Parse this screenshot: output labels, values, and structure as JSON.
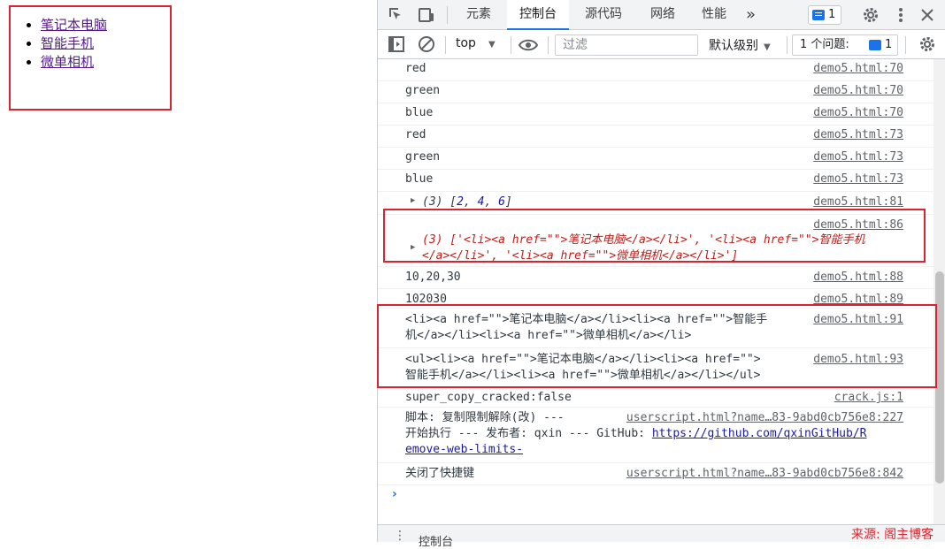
{
  "page": {
    "list": [
      {
        "label": "笔记本电脑"
      },
      {
        "label": "智能手机"
      },
      {
        "label": "微单相机"
      }
    ]
  },
  "devtools": {
    "tabs": [
      {
        "label": "元素",
        "active": false
      },
      {
        "label": "控制台",
        "active": true
      },
      {
        "label": "源代码",
        "active": false
      },
      {
        "label": "网络",
        "active": false
      },
      {
        "label": "性能",
        "active": false
      }
    ],
    "more_tabs": "»",
    "issue_badge_count": "1",
    "toolbar": {
      "context": "top",
      "filter_placeholder": "过滤",
      "level": "默认级别",
      "issues_label": "1 个问题:",
      "issues_count": "1"
    },
    "console": {
      "rows": [
        {
          "msg": "red",
          "src": "demo5.html:70"
        },
        {
          "msg": "green",
          "src": "demo5.html:70"
        },
        {
          "msg": "blue",
          "src": "demo5.html:70"
        },
        {
          "msg": "red",
          "src": "demo5.html:73"
        },
        {
          "msg": "green",
          "src": "demo5.html:73"
        },
        {
          "msg": "blue",
          "src": "demo5.html:73"
        }
      ],
      "array_row": {
        "prefix": "(3) [",
        "nums": [
          "2",
          "4",
          "6"
        ],
        "src": "demo5.html:81"
      },
      "strarr_row": {
        "line1": "(3) ['<li><a href=\"\">笔记本电脑</a></li>', '<li><a href=\"\">智能手机",
        "line2": "</a></li>', '<li><a href=\"\">微单相机</a></li>']",
        "src": "demo5.html:86"
      },
      "join_row": {
        "msg": "10,20,30",
        "src": "demo5.html:88"
      },
      "concat_row": {
        "msg": "102030",
        "src": "demo5.html:89"
      },
      "li_row": {
        "line1": "<li><a href=\"\">笔记本电脑</a></li><li><a href=\"\">智能手",
        "line2": "机</a></li><li><a href=\"\">微单相机</a></li>",
        "src": "demo5.html:91"
      },
      "ul_row": {
        "line1": "<ul><li><a href=\"\">笔记本电脑</a></li><li><a href=\"\">",
        "line2": "智能手机</a></li><li><a href=\"\">微单相机</a></li></ul>",
        "src": "demo5.html:93"
      },
      "crack_row": {
        "msg": "super_copy_cracked:false",
        "src": "crack.js:1"
      },
      "script_row": {
        "line1": "脚本: 复制限制解除(改) ---",
        "line2_prefix": "开始执行 --- 发布者: qxin --- GitHub: ",
        "line2_link": "https://github.com/qxinGitHub/R",
        "line3_link": "emove-web-limits-",
        "src": "userscript.html?name…83-9abd0cb756e8:227"
      },
      "shortcut_row": {
        "msg": "关闭了快捷键",
        "src": "userscript.html?name…83-9abd0cb756e8:842"
      }
    },
    "drawer": {
      "tab_label": "控制台"
    }
  },
  "watermark": "来源: 阁主博客"
}
